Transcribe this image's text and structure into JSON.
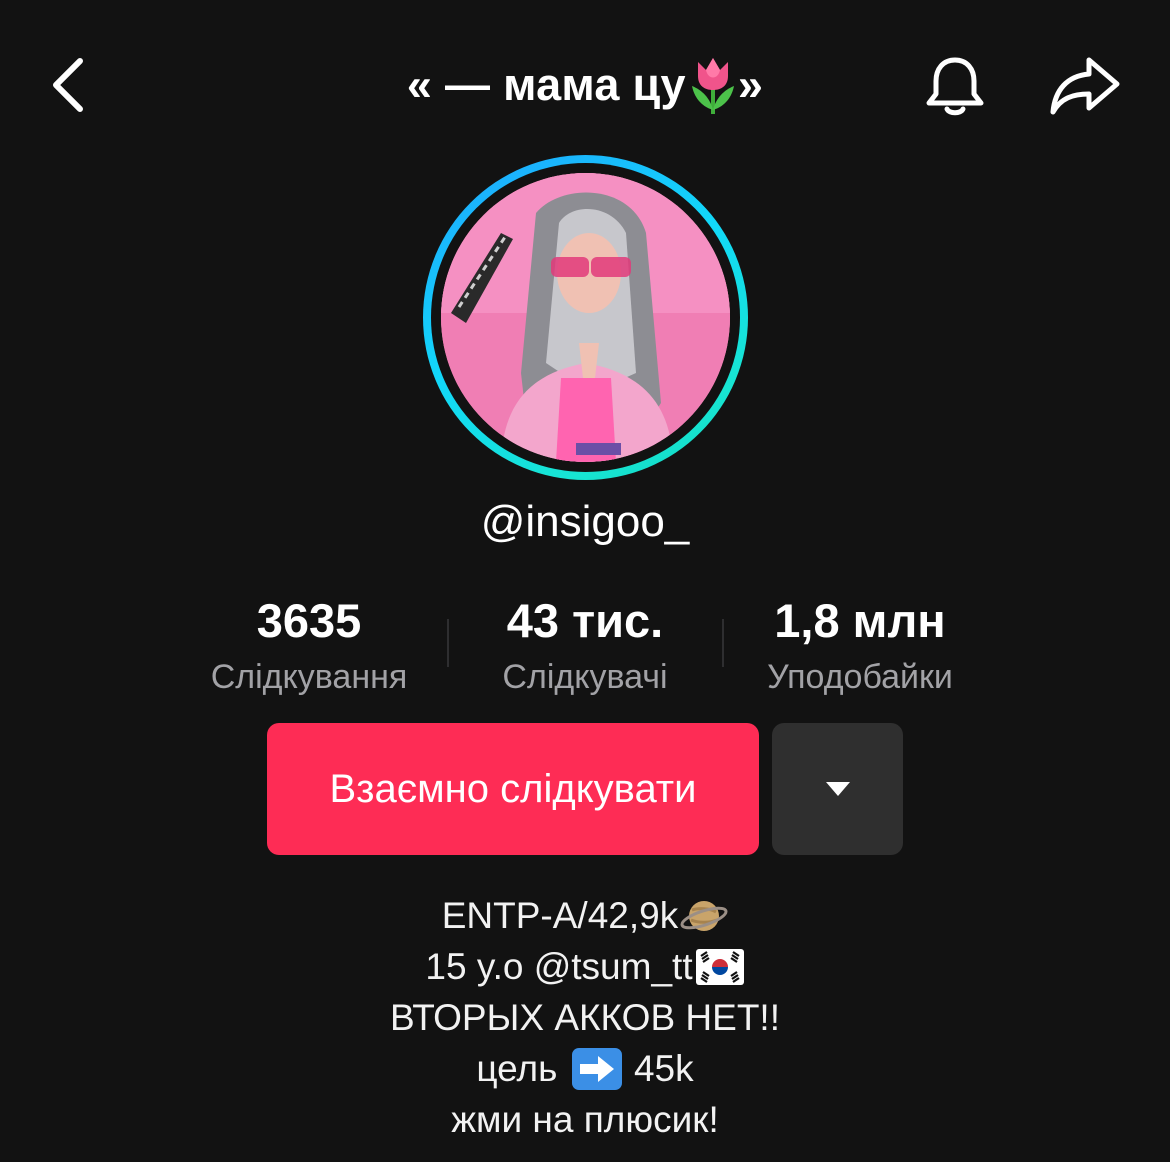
{
  "header": {
    "title": "« — мама цу",
    "title_end": " »",
    "title_emoji": "tulip-emoji",
    "back_icon": "chevron-left-icon",
    "notifications_icon": "bell-icon",
    "share_icon": "share-arrow-icon"
  },
  "profile": {
    "avatar": "profile-photo",
    "avatar_ring_color": "#12d8fa",
    "username": "@insigoo_"
  },
  "stats": {
    "following": {
      "value": "3635",
      "label": "Слідкування"
    },
    "followers": {
      "value": "43 тис.",
      "label": "Слідкувачі"
    },
    "likes": {
      "value": "1,8 млн",
      "label": "Уподобайки"
    }
  },
  "actions": {
    "follow_back_label": "Взаємно слідкувати",
    "follow_back_color": "#fe2c55",
    "more_icon": "caret-down-icon"
  },
  "bio": {
    "line1": "ENTP-A/42,9k",
    "line1_emoji": "ringed-planet-emoji",
    "line2": "15 y.o @tsum_tt",
    "line2_emoji": "south-korea-flag-emoji",
    "line3": "ВТОРЫХ АККОВ НЕТ!!",
    "line4_start": "цель ",
    "line4_emoji": "right-arrow-emoji",
    "line4_end": " 45k",
    "line5": "жми на плюсик!"
  }
}
